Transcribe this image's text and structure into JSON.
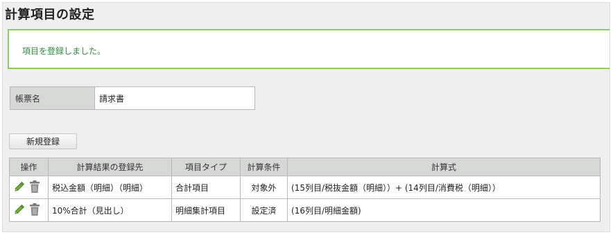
{
  "page": {
    "title": "計算項目の設定",
    "alert_message": "項目を登録しました。"
  },
  "form": {
    "label": "帳票名",
    "value": "請求書"
  },
  "actions": {
    "new_button_label": "新規登録"
  },
  "table": {
    "headers": {
      "ops": "操作",
      "target": "計算結果の登録先",
      "type": "項目タイプ",
      "condition": "計算条件",
      "formula": "計算式"
    },
    "rows": [
      {
        "target": "税込金額（明細）（明細）",
        "type": "合計項目",
        "condition": "対象外",
        "formula": "(15列目/税抜金額（明細））+ (14列目/消費税（明細））"
      },
      {
        "target": "10%合計（見出し）",
        "type": "明細集計項目",
        "condition": "設定済",
        "formula": "(16列目/明細金額)"
      }
    ]
  },
  "icons": {
    "edit": "pencil-icon",
    "delete": "trash-icon"
  },
  "colors": {
    "alert_border": "#8dcf5a",
    "alert_text": "#2e8b3a",
    "header_bg": "#d6d8d6"
  }
}
